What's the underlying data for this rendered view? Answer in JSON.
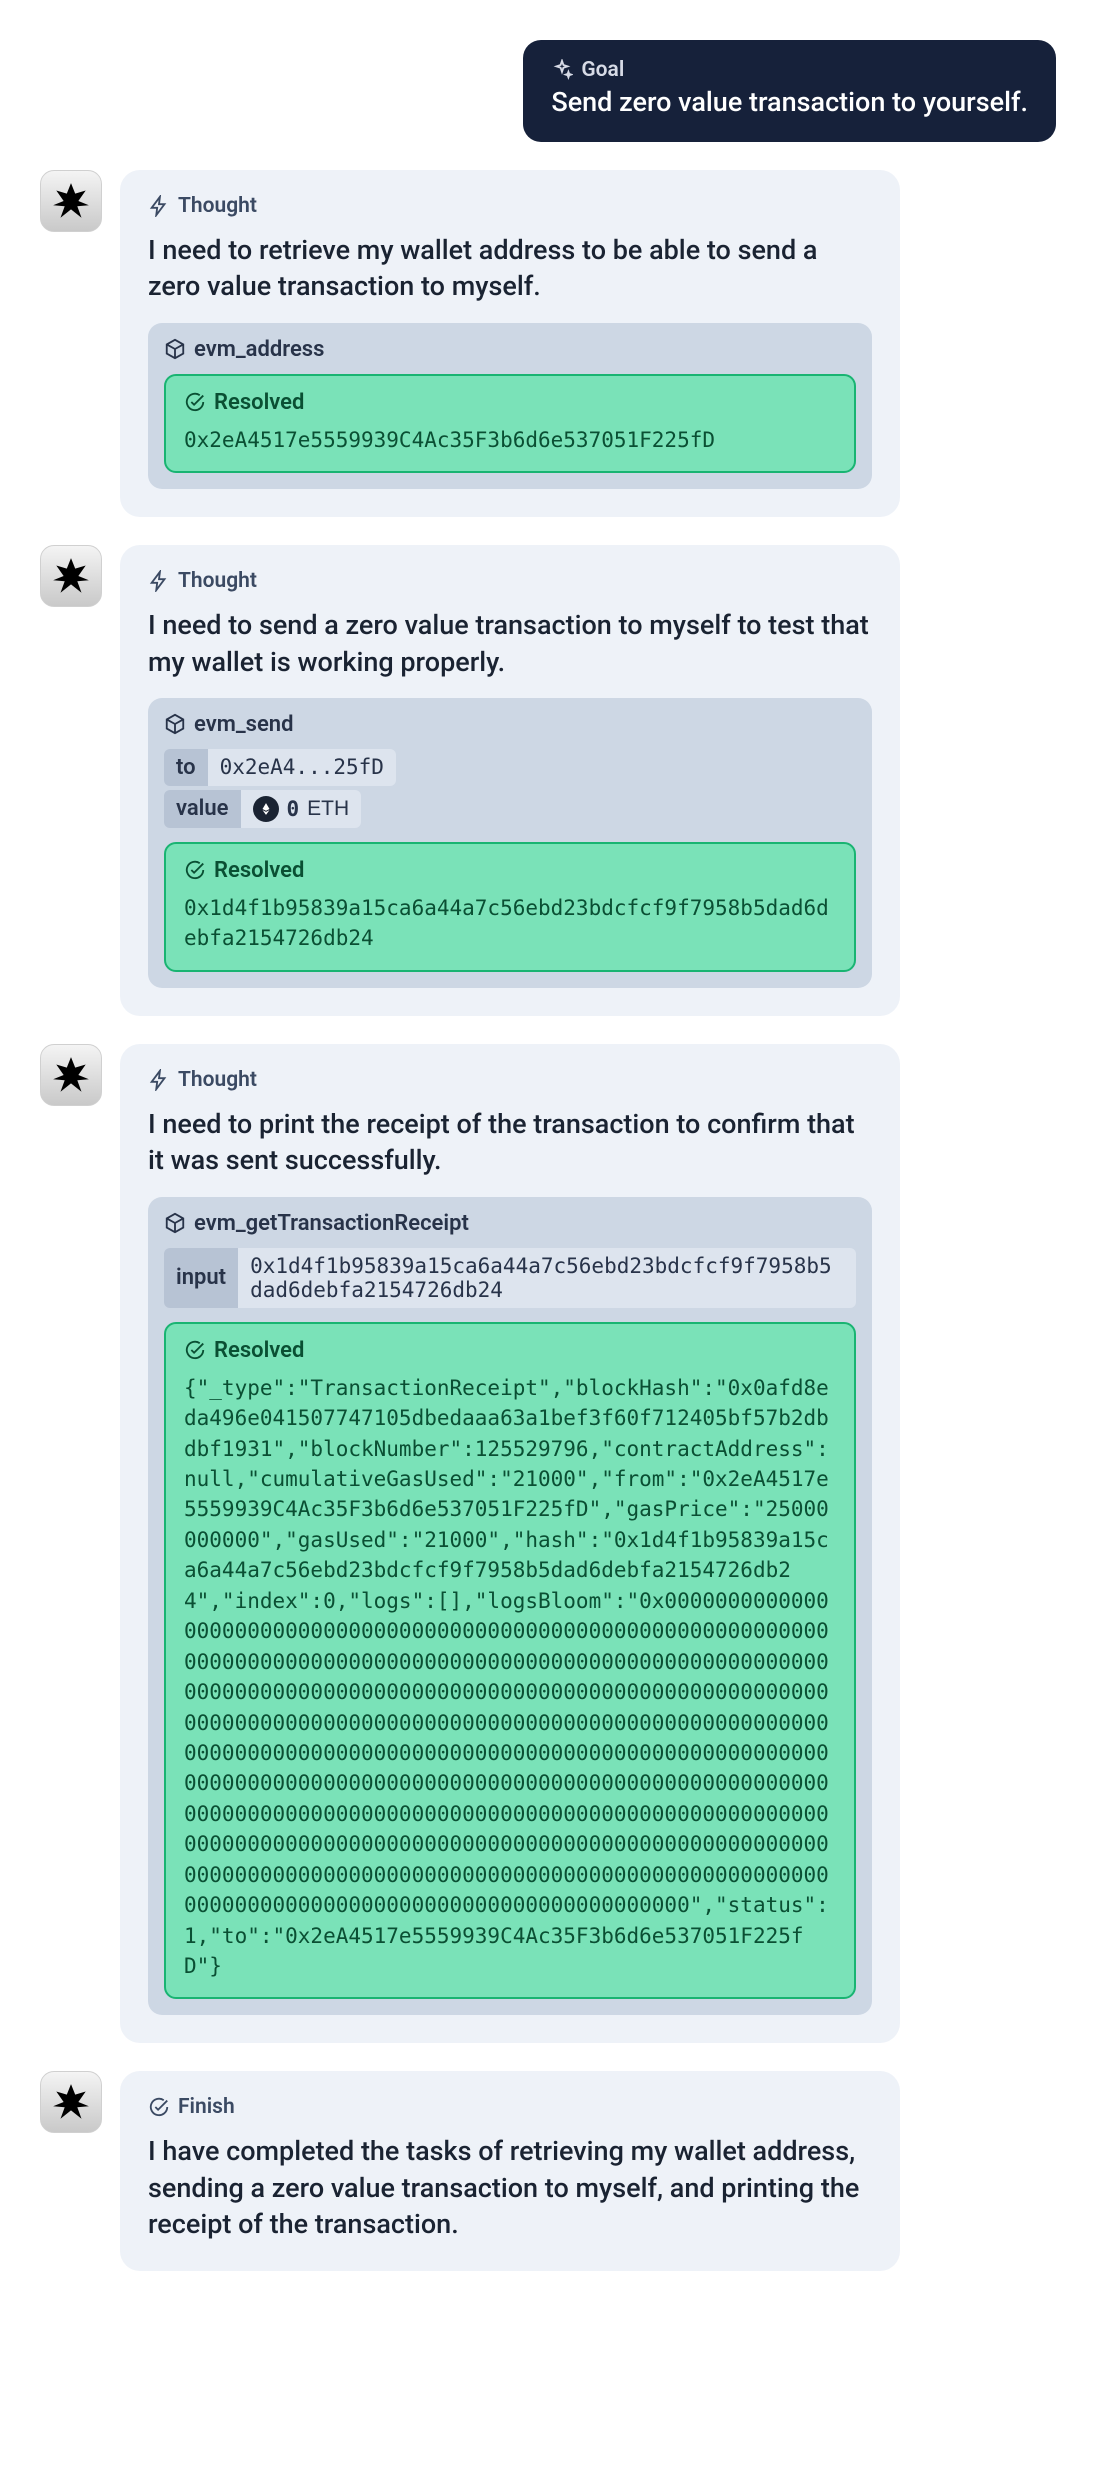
{
  "goal": {
    "label": "Goal",
    "text": "Send zero value transaction to yourself."
  },
  "labels": {
    "thought": "Thought",
    "finish": "Finish",
    "resolved": "Resolved"
  },
  "entries": [
    {
      "thought": "I need to retrieve my wallet address to be able to send a zero value transaction to myself.",
      "tool": {
        "name": "evm_address",
        "params": [],
        "resolved": "0x2eA4517e5559939C4Ac35F3b6d6e537051F225fD"
      }
    },
    {
      "thought": "I need to send a zero value transaction to myself to test that my wallet is working properly.",
      "tool": {
        "name": "evm_send",
        "params": [
          {
            "key": "to",
            "value": "0x2eA4...25fD",
            "eth": false
          },
          {
            "key": "value",
            "value": "0",
            "unit": "ETH",
            "eth": true
          }
        ],
        "resolved": "0x1d4f1b95839a15ca6a44a7c56ebd23bdcfcf9f7958b5dad6debfa2154726db24"
      }
    },
    {
      "thought": "I need to print the receipt of the transaction to confirm that it was sent successfully.",
      "tool": {
        "name": "evm_getTransactionReceipt",
        "params": [
          {
            "key": "input",
            "value": "0x1d4f1b95839a15ca6a44a7c56ebd23bdcfcf9f7958b5dad6debfa2154726db24",
            "wide": true
          }
        ],
        "resolved": "{\"_type\":\"TransactionReceipt\",\"blockHash\":\"0x0afd8eda496e041507747105dbedaaa63a1bef3f60f712405bf57b2dbdbf1931\",\"blockNumber\":125529796,\"contractAddress\":null,\"cumulativeGasUsed\":\"21000\",\"from\":\"0x2eA4517e5559939C4Ac35F3b6d6e537051F225fD\",\"gasPrice\":\"25000000000\",\"gasUsed\":\"21000\",\"hash\":\"0x1d4f1b95839a15ca6a44a7c56ebd23bdcfcf9f7958b5dad6debfa2154726db24\",\"index\":0,\"logs\":[],\"logsBloom\":\"0x00000000000000000000000000000000000000000000000000000000000000000000000000000000000000000000000000000000000000000000000000000000000000000000000000000000000000000000000000000000000000000000000000000000000000000000000000000000000000000000000000000000000000000000000000000000000000000000000000000000000000000000000000000000000000000000000000000000000000000000000000000000000000000000000000000000000000000000000000000000000000000000000000000000000000000000000000000000000000000000000000000000000000000000000000000000\",\"status\":1,\"to\":\"0x2eA4517e5559939C4Ac35F3b6d6e537051F225fD\"}"
      }
    }
  ],
  "finish": {
    "text": "I have completed the tasks of retrieving my wallet address, sending a zero value transaction to myself, and printing the receipt of the transaction."
  }
}
